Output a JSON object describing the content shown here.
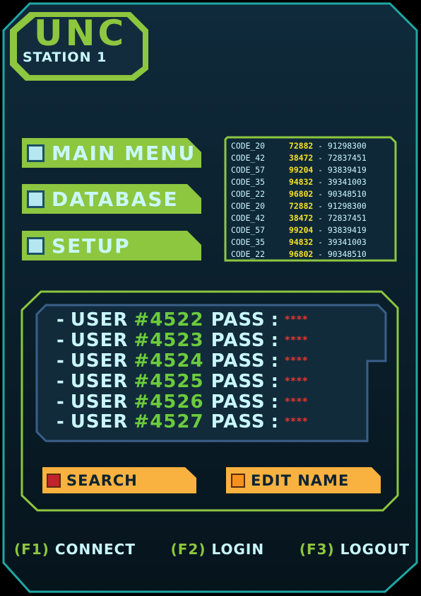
{
  "header": {
    "title": "UNC",
    "subtitle": "STATION 1"
  },
  "menu": {
    "items": [
      {
        "label": "MAIN MENU"
      },
      {
        "label": "DATABASE"
      },
      {
        "label": "SETUP"
      }
    ]
  },
  "codes": {
    "rows": [
      {
        "label": "CODE_20",
        "value": "72882",
        "suffix": "- 91298300"
      },
      {
        "label": "CODE_42",
        "value": "38472",
        "suffix": "- 72837451"
      },
      {
        "label": "CODE_57",
        "value": "99204",
        "suffix": "- 93839419"
      },
      {
        "label": "CODE_35",
        "value": "94832",
        "suffix": "- 39341003"
      },
      {
        "label": "CODE_22",
        "value": "96802",
        "suffix": "- 90348510"
      },
      {
        "label": "CODE_20",
        "value": "72882",
        "suffix": "- 91298300"
      },
      {
        "label": "CODE_42",
        "value": "38472",
        "suffix": "- 72837451"
      },
      {
        "label": "CODE_57",
        "value": "99204",
        "suffix": "- 93839419"
      },
      {
        "label": "CODE_35",
        "value": "94832",
        "suffix": "- 39341003"
      },
      {
        "label": "CODE_22",
        "value": "96802",
        "suffix": "- 90348510"
      }
    ]
  },
  "users": {
    "rows": [
      {
        "dash": "-",
        "user_label": "USER",
        "id": "#4522",
        "pass_label": "PASS",
        "colon": ":",
        "masked": "****"
      },
      {
        "dash": "-",
        "user_label": "USER",
        "id": "#4523",
        "pass_label": "PASS",
        "colon": ":",
        "masked": "****"
      },
      {
        "dash": "-",
        "user_label": "USER",
        "id": "#4524",
        "pass_label": "PASS",
        "colon": ":",
        "masked": "****"
      },
      {
        "dash": "-",
        "user_label": "USER",
        "id": "#4525",
        "pass_label": "PASS",
        "colon": ":",
        "masked": "****"
      },
      {
        "dash": "-",
        "user_label": "USER",
        "id": "#4526",
        "pass_label": "PASS",
        "colon": ":",
        "masked": "****"
      },
      {
        "dash": "-",
        "user_label": "USER",
        "id": "#4527",
        "pass_label": "PASS",
        "colon": ":",
        "masked": "****"
      }
    ]
  },
  "actions": {
    "search": {
      "label": "SEARCH"
    },
    "edit": {
      "label": "EDIT NAME"
    }
  },
  "footer": {
    "f1": {
      "key": "(F1)",
      "label": "CONNECT"
    },
    "f2": {
      "key": "(F2)",
      "label": "LOGIN"
    },
    "f3": {
      "key": "(F3)",
      "label": "LOGOUT"
    }
  },
  "colors": {
    "frame": "#1fa7a4",
    "accent_green": "#8dc63f",
    "text_light": "#c9f7ff",
    "code_highlight": "#f1e325",
    "action_orange": "#f9b240",
    "search_check": "#c0242d",
    "edit_check": "#f6901e"
  }
}
